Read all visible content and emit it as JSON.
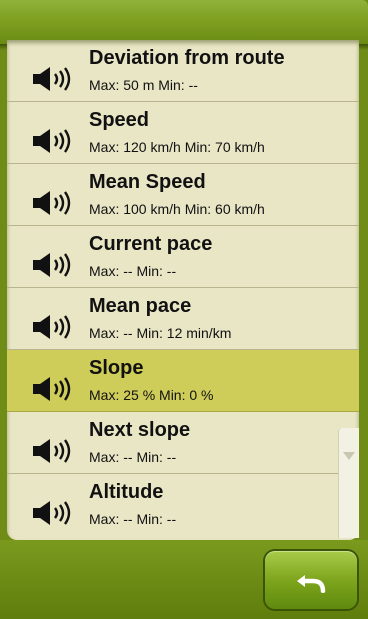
{
  "list": {
    "items": [
      {
        "title": "Deviation from route",
        "sub": "Max: 50 m Min: --"
      },
      {
        "title": "Speed",
        "sub": "Max: 120 km/h Min: 70 km/h"
      },
      {
        "title": "Mean Speed",
        "sub": "Max: 100 km/h Min: 60 km/h"
      },
      {
        "title": "Current pace",
        "sub": "Max: -- Min: --"
      },
      {
        "title": "Mean pace",
        "sub": "Max: -- Min: 12 min/km"
      },
      {
        "title": "Slope",
        "sub": "Max: 25 % Min: 0 %"
      },
      {
        "title": "Next slope",
        "sub": "Max: -- Min: --"
      },
      {
        "title": "Altitude",
        "sub": "Max: -- Min: --"
      }
    ],
    "selected_index": 5,
    "item_icon": "speaker-icon"
  },
  "footer": {
    "back_icon": "undo-arrow-icon"
  },
  "colors": {
    "frame": "#6f8c16",
    "list_bg": "#e9e6c6",
    "selected_bg": "#cfcd5a",
    "button": "#7ea51d"
  }
}
